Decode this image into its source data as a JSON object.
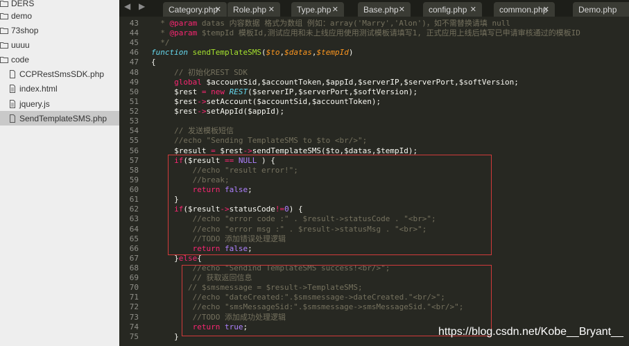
{
  "sidebar": {
    "items": [
      {
        "label": "DERS",
        "type": "folder-open",
        "depth": 0
      },
      {
        "label": "demo",
        "type": "folder",
        "depth": 0
      },
      {
        "label": "73shop",
        "type": "folder",
        "depth": 0
      },
      {
        "label": "uuuu",
        "type": "folder",
        "depth": 0
      },
      {
        "label": "code",
        "type": "folder-open",
        "depth": 0
      },
      {
        "label": "CCPRestSmsSDK.php",
        "type": "file",
        "depth": 1
      },
      {
        "label": "index.html",
        "type": "file-lines",
        "depth": 1
      },
      {
        "label": "jquery.js",
        "type": "file-lines",
        "depth": 1
      },
      {
        "label": "SendTemplateSMS.php",
        "type": "file",
        "depth": 1,
        "selected": true
      }
    ]
  },
  "tabs": [
    {
      "label": "Category.php"
    },
    {
      "label": "Role.php"
    },
    {
      "label": "Type.php"
    },
    {
      "label": "Base.php"
    },
    {
      "label": "config.php"
    },
    {
      "label": "common.php"
    },
    {
      "label": "Demo.php"
    }
  ],
  "editor": {
    "lines": [
      {
        "num": "43",
        "tokens": [
          {
            "t": "  * ",
            "c": "c"
          },
          {
            "t": "@param",
            "c": "k"
          },
          {
            "t": " datas 内容数据 格式为数组 例如：array('Marry','Alon')，如不需替换请填 null",
            "c": "c"
          }
        ]
      },
      {
        "num": "44",
        "tokens": [
          {
            "t": "  * ",
            "c": "c"
          },
          {
            "t": "@param",
            "c": "k"
          },
          {
            "t": " $tempId 模板Id,测试应用和未上线应用使用测试模板请填写1, 正式应用上线后填写已申请审核通过的模板ID",
            "c": "c"
          }
        ]
      },
      {
        "num": "45",
        "tokens": [
          {
            "t": "  */",
            "c": "c"
          }
        ]
      },
      {
        "num": "46",
        "tokens": [
          {
            "t": "function",
            "c": "st"
          },
          {
            "t": " ",
            "c": "v"
          },
          {
            "t": "sendTemplateSMS",
            "c": "f"
          },
          {
            "t": "(",
            "c": "v"
          },
          {
            "t": "$to",
            "c": "p"
          },
          {
            "t": ",",
            "c": "v"
          },
          {
            "t": "$datas",
            "c": "p"
          },
          {
            "t": ",",
            "c": "v"
          },
          {
            "t": "$tempId",
            "c": "p"
          },
          {
            "t": ")",
            "c": "v"
          }
        ]
      },
      {
        "num": "47",
        "tokens": [
          {
            "t": "{",
            "c": "v"
          }
        ]
      },
      {
        "num": "48",
        "tokens": [
          {
            "t": "     // 初始化REST SDK",
            "c": "c"
          }
        ]
      },
      {
        "num": "49",
        "tokens": [
          {
            "t": "     ",
            "c": "v"
          },
          {
            "t": "global",
            "c": "k"
          },
          {
            "t": " $accountSid,$accountToken,$appId,$serverIP,$serverPort,$softVersion;",
            "c": "v"
          }
        ]
      },
      {
        "num": "50",
        "tokens": [
          {
            "t": "     $rest ",
            "c": "v"
          },
          {
            "t": "=",
            "c": "k"
          },
          {
            "t": " ",
            "c": "v"
          },
          {
            "t": "new",
            "c": "k"
          },
          {
            "t": " ",
            "c": "v"
          },
          {
            "t": "REST",
            "c": "st"
          },
          {
            "t": "($serverIP,$serverPort,$softVersion);",
            "c": "v"
          }
        ]
      },
      {
        "num": "51",
        "tokens": [
          {
            "t": "     $rest",
            "c": "v"
          },
          {
            "t": "->",
            "c": "k"
          },
          {
            "t": "setAccount($accountSid,$accountToken);",
            "c": "v"
          }
        ]
      },
      {
        "num": "52",
        "tokens": [
          {
            "t": "     $rest",
            "c": "v"
          },
          {
            "t": "->",
            "c": "k"
          },
          {
            "t": "setAppId($appId);",
            "c": "v"
          }
        ]
      },
      {
        "num": "53",
        "tokens": [
          {
            "t": "",
            "c": "v"
          }
        ]
      },
      {
        "num": "54",
        "tokens": [
          {
            "t": "     // 发送模板短信",
            "c": "c"
          }
        ]
      },
      {
        "num": "55",
        "tokens": [
          {
            "t": "     //echo \"Sending TemplateSMS to $to <br/>\";",
            "c": "c"
          }
        ]
      },
      {
        "num": "56",
        "tokens": [
          {
            "t": "     $result ",
            "c": "v"
          },
          {
            "t": "=",
            "c": "k"
          },
          {
            "t": " $rest",
            "c": "v"
          },
          {
            "t": "->",
            "c": "k"
          },
          {
            "t": "sendTemplateSMS($to,$datas,$tempId);",
            "c": "v"
          }
        ]
      },
      {
        "num": "57",
        "tokens": [
          {
            "t": "     ",
            "c": "v"
          },
          {
            "t": "if",
            "c": "k"
          },
          {
            "t": "($result ",
            "c": "v"
          },
          {
            "t": "==",
            "c": "k"
          },
          {
            "t": " ",
            "c": "v"
          },
          {
            "t": "NULL",
            "c": "n"
          },
          {
            "t": " ) {",
            "c": "v"
          }
        ]
      },
      {
        "num": "58",
        "tokens": [
          {
            "t": "         //echo \"result error!\";",
            "c": "c"
          }
        ]
      },
      {
        "num": "59",
        "tokens": [
          {
            "t": "         //break;",
            "c": "c"
          }
        ]
      },
      {
        "num": "60",
        "tokens": [
          {
            "t": "         ",
            "c": "v"
          },
          {
            "t": "return",
            "c": "k"
          },
          {
            "t": " ",
            "c": "v"
          },
          {
            "t": "false",
            "c": "n"
          },
          {
            "t": ";",
            "c": "v"
          }
        ]
      },
      {
        "num": "61",
        "tokens": [
          {
            "t": "     }",
            "c": "v"
          }
        ]
      },
      {
        "num": "62",
        "tokens": [
          {
            "t": "     ",
            "c": "v"
          },
          {
            "t": "if",
            "c": "k"
          },
          {
            "t": "($result",
            "c": "v"
          },
          {
            "t": "->",
            "c": "k"
          },
          {
            "t": "statusCode",
            "c": "v"
          },
          {
            "t": "!=",
            "c": "k"
          },
          {
            "t": "0",
            "c": "n"
          },
          {
            "t": ") {",
            "c": "v"
          }
        ]
      },
      {
        "num": "63",
        "tokens": [
          {
            "t": "         //echo \"error code :\" . $result->statusCode . \"<br>\";",
            "c": "c"
          }
        ]
      },
      {
        "num": "64",
        "tokens": [
          {
            "t": "         //echo \"error msg :\" . $result->statusMsg . \"<br>\";",
            "c": "c"
          }
        ]
      },
      {
        "num": "65",
        "tokens": [
          {
            "t": "         //TODO 添加错误处理逻辑",
            "c": "c"
          }
        ]
      },
      {
        "num": "66",
        "tokens": [
          {
            "t": "         ",
            "c": "v"
          },
          {
            "t": "return",
            "c": "k"
          },
          {
            "t": " ",
            "c": "v"
          },
          {
            "t": "false",
            "c": "n"
          },
          {
            "t": ";",
            "c": "v"
          }
        ]
      },
      {
        "num": "67",
        "tokens": [
          {
            "t": "     }",
            "c": "v"
          },
          {
            "t": "else",
            "c": "k"
          },
          {
            "t": "{",
            "c": "v"
          }
        ]
      },
      {
        "num": "68",
        "tokens": [
          {
            "t": "         //echo \"Sendind TemplateSMS success!<br/>\";",
            "c": "c"
          }
        ]
      },
      {
        "num": "69",
        "tokens": [
          {
            "t": "         // 获取返回信息",
            "c": "c"
          }
        ]
      },
      {
        "num": "70",
        "tokens": [
          {
            "t": "        // $smsmessage = $result->TemplateSMS;",
            "c": "c"
          }
        ]
      },
      {
        "num": "71",
        "tokens": [
          {
            "t": "         //echo \"dateCreated:\".$smsmessage->dateCreated.\"<br/>\";",
            "c": "c"
          }
        ]
      },
      {
        "num": "72",
        "tokens": [
          {
            "t": "         //echo \"smsMessageSid:\".$smsmessage->smsMessageSid.\"<br/>\";",
            "c": "c"
          }
        ]
      },
      {
        "num": "73",
        "tokens": [
          {
            "t": "         //TODO 添加成功处理逻辑",
            "c": "c"
          }
        ]
      },
      {
        "num": "74",
        "tokens": [
          {
            "t": "         ",
            "c": "v"
          },
          {
            "t": "return",
            "c": "k"
          },
          {
            "t": " ",
            "c": "v"
          },
          {
            "t": "true",
            "c": "n"
          },
          {
            "t": ";",
            "c": "v"
          }
        ]
      },
      {
        "num": "75",
        "tokens": [
          {
            "t": "     }",
            "c": "v"
          }
        ]
      }
    ]
  },
  "watermark": "https://blog.csdn.net/Kobe__Bryant__",
  "colors": {
    "highlight_border": "#d23b3b",
    "editor_bg": "#272822"
  }
}
